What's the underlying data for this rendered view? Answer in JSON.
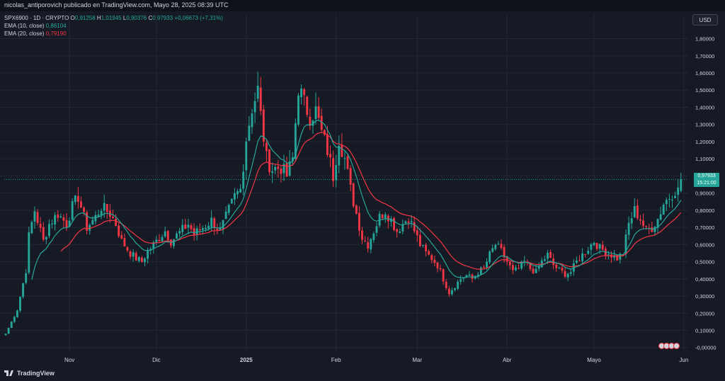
{
  "credit": "nicolas_antiporovich publicado en TradingView.com, Mayo 28, 2025 08:39 UTC",
  "legend": {
    "symbol": "SPX6900 · 1D · CRYPTO",
    "o_label": "O",
    "o_value": "0,91258",
    "h_label": "H",
    "h_value": "1,01945",
    "l_label": "L",
    "l_value": "0,90376",
    "c_label": "C",
    "c_value": "0,97933",
    "change": "+0,06673 (+7,31%)",
    "ema10_label": "EMA (10, close)",
    "ema10_value": "0,86104",
    "ema20_label": "EMA (20, close)",
    "ema20_value": "0,79190"
  },
  "currency": "USD",
  "price_tag": {
    "price": "0,97933",
    "countdown": "15:21:00"
  },
  "watermark": "TradingView",
  "colors": {
    "up": "#26a69a",
    "down": "#f23645",
    "ema10": "#26a69a",
    "ema20": "#f23645",
    "background": "#161a25",
    "grid": "#242832"
  },
  "chart_data": {
    "type": "candlestick",
    "y_tick_labels": [
      "1,80000",
      "1,70000",
      "1,60000",
      "1,50000",
      "1,40000",
      "1,30000",
      "1,20000",
      "1,10000",
      "1,00000",
      "0,90000",
      "0,80000",
      "0,70000",
      "0,60000",
      "0,50000",
      "0,40000",
      "0,30000",
      "0,20000",
      "0,10000",
      "-0,00000"
    ],
    "y_ticks": [
      1.8,
      1.7,
      1.6,
      1.5,
      1.4,
      1.3,
      1.2,
      1.1,
      1.0,
      0.9,
      0.8,
      0.7,
      0.6,
      0.5,
      0.4,
      0.3,
      0.2,
      0.1,
      0.0
    ],
    "ylim": [
      -0.03,
      1.86
    ],
    "x_labels": [
      {
        "label": "Nov",
        "day": 22
      },
      {
        "label": "Dic",
        "day": 52
      },
      {
        "label": "2025",
        "day": 83
      },
      {
        "label": "Feb",
        "day": 114
      },
      {
        "label": "Mar",
        "day": 142
      },
      {
        "label": "Abr",
        "day": 173
      },
      {
        "label": "Mayo",
        "day": 203
      },
      {
        "label": "Jun",
        "day": 234
      }
    ],
    "num_days": 236,
    "last_close": 0.97933,
    "ema10_last": 0.86104,
    "ema20_last": 0.7919,
    "close_anchors": [
      [
        0,
        0.08
      ],
      [
        4,
        0.22
      ],
      [
        7,
        0.45
      ],
      [
        8,
        0.65
      ],
      [
        10,
        0.8
      ],
      [
        13,
        0.62
      ],
      [
        15,
        0.72
      ],
      [
        18,
        0.78
      ],
      [
        21,
        0.72
      ],
      [
        23,
        0.82
      ],
      [
        25,
        0.88
      ],
      [
        28,
        0.7
      ],
      [
        31,
        0.76
      ],
      [
        33,
        0.82
      ],
      [
        36,
        0.78
      ],
      [
        38,
        0.72
      ],
      [
        40,
        0.62
      ],
      [
        43,
        0.55
      ],
      [
        45,
        0.52
      ],
      [
        47,
        0.5
      ],
      [
        49,
        0.56
      ],
      [
        52,
        0.62
      ],
      [
        55,
        0.68
      ],
      [
        57,
        0.62
      ],
      [
        60,
        0.67
      ],
      [
        63,
        0.72
      ],
      [
        65,
        0.66
      ],
      [
        68,
        0.7
      ],
      [
        71,
        0.74
      ],
      [
        74,
        0.68
      ],
      [
        77,
        0.8
      ],
      [
        79,
        0.88
      ],
      [
        81,
        0.92
      ],
      [
        83,
        1.22
      ],
      [
        85,
        1.4
      ],
      [
        87,
        1.5
      ],
      [
        88,
        1.35
      ],
      [
        90,
        1.1
      ],
      [
        92,
        1.04
      ],
      [
        95,
        1.05
      ],
      [
        97,
        1.0
      ],
      [
        99,
        1.1
      ],
      [
        101,
        1.52
      ],
      [
        103,
        1.42
      ],
      [
        105,
        1.35
      ],
      [
        107,
        1.38
      ],
      [
        109,
        1.25
      ],
      [
        111,
        1.15
      ],
      [
        113,
        1.0
      ],
      [
        115,
        1.22
      ],
      [
        117,
        1.1
      ],
      [
        119,
        0.92
      ],
      [
        121,
        0.78
      ],
      [
        123,
        0.64
      ],
      [
        125,
        0.6
      ],
      [
        127,
        0.68
      ],
      [
        129,
        0.76
      ],
      [
        131,
        0.8
      ],
      [
        133,
        0.74
      ],
      [
        135,
        0.68
      ],
      [
        137,
        0.72
      ],
      [
        139,
        0.76
      ],
      [
        141,
        0.68
      ],
      [
        143,
        0.6
      ],
      [
        145,
        0.55
      ],
      [
        147,
        0.52
      ],
      [
        149,
        0.48
      ],
      [
        151,
        0.4
      ],
      [
        153,
        0.32
      ],
      [
        155,
        0.36
      ],
      [
        157,
        0.4
      ],
      [
        159,
        0.42
      ],
      [
        161,
        0.4
      ],
      [
        163,
        0.44
      ],
      [
        165,
        0.46
      ],
      [
        167,
        0.54
      ],
      [
        169,
        0.6
      ],
      [
        171,
        0.56
      ],
      [
        173,
        0.5
      ],
      [
        175,
        0.44
      ],
      [
        177,
        0.46
      ],
      [
        179,
        0.5
      ],
      [
        181,
        0.46
      ],
      [
        183,
        0.44
      ],
      [
        185,
        0.5
      ],
      [
        187,
        0.54
      ],
      [
        189,
        0.48
      ],
      [
        191,
        0.45
      ],
      [
        193,
        0.43
      ],
      [
        195,
        0.44
      ],
      [
        197,
        0.5
      ],
      [
        199,
        0.54
      ],
      [
        201,
        0.58
      ],
      [
        203,
        0.62
      ],
      [
        205,
        0.58
      ],
      [
        207,
        0.56
      ],
      [
        209,
        0.54
      ],
      [
        211,
        0.52
      ],
      [
        213,
        0.55
      ],
      [
        215,
        0.72
      ],
      [
        217,
        0.8
      ],
      [
        219,
        0.75
      ],
      [
        221,
        0.68
      ],
      [
        223,
        0.7
      ],
      [
        225,
        0.75
      ],
      [
        227,
        0.84
      ],
      [
        229,
        0.88
      ],
      [
        231,
        0.92
      ],
      [
        232,
        0.91258
      ],
      [
        233,
        0.97933
      ]
    ],
    "series": [
      {
        "name": "EMA (10, close)",
        "type": "line"
      },
      {
        "name": "EMA (20, close)",
        "type": "line"
      }
    ]
  }
}
